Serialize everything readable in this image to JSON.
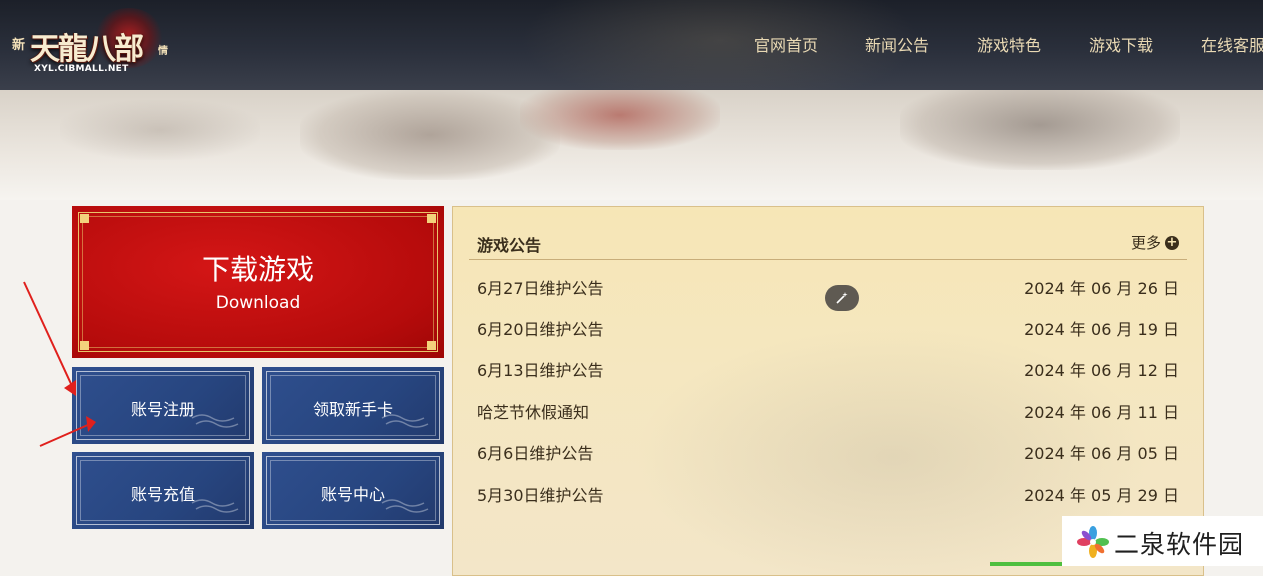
{
  "logo": {
    "prefix": "新",
    "title": "天龍八部",
    "suffix": "情",
    "url": "XYL.CIBMALL.NET"
  },
  "nav": [
    "官网首页",
    "新闻公告",
    "游戏特色",
    "游戏下载",
    "在线客服"
  ],
  "download": {
    "title": "下载游戏",
    "subtitle": "Download"
  },
  "buttons": [
    "账号注册",
    "领取新手卡",
    "账号充值",
    "账号中心"
  ],
  "notice": {
    "title": "游戏公告",
    "more": "更多",
    "items": [
      {
        "title": "6月27日维护公告",
        "date": "2024 年 06 月 26 日"
      },
      {
        "title": "6月20日维护公告",
        "date": "2024 年 06 月 19 日"
      },
      {
        "title": "6月13日维护公告",
        "date": "2024 年 06 月 12 日"
      },
      {
        "title": "哈芝节休假通知",
        "date": "2024 年 06 月 11 日"
      },
      {
        "title": "6月6日维护公告",
        "date": "2024 年 06 月 05 日"
      },
      {
        "title": "5月30日维护公告",
        "date": "2024 年 05 月 29 日"
      }
    ]
  },
  "watermark": {
    "text": "二泉软件园"
  },
  "colors": {
    "header_bg": "#242833",
    "nav_text": "#e9d9b4",
    "download_red": "#c40f0f",
    "button_blue": "#2b4884",
    "notice_bg": "#f6e6b6",
    "arrow_red": "#e0201c"
  }
}
